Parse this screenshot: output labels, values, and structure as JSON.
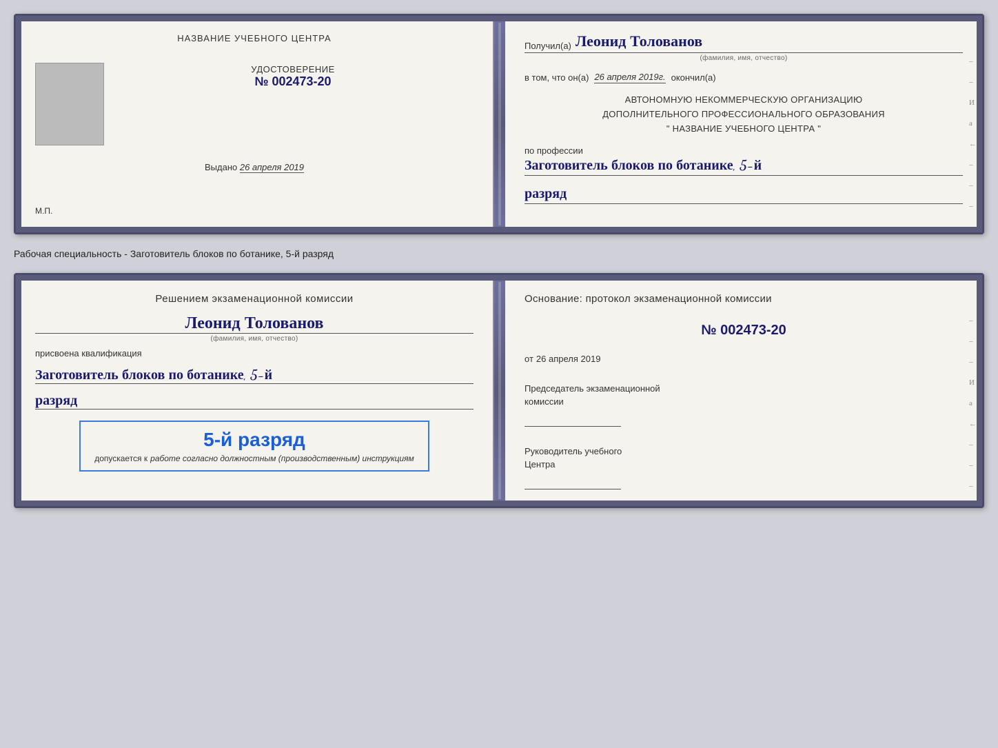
{
  "topCard": {
    "left": {
      "title": "НАЗВАНИЕ УЧЕБНОГО ЦЕНТРА",
      "certLabel": "УДОСТОВЕРЕНИЕ",
      "certNumber": "№ 002473-20",
      "issuedPrefix": "Выдано",
      "issuedDate": "26 апреля 2019",
      "mpLabel": "М.П."
    },
    "right": {
      "recipientPrefix": "Получил(а)",
      "recipientName": "Леонид Толованов",
      "recipientCaption": "(фамилия, имя, отчество)",
      "datePrefix": "в том, что он(а)",
      "date": "26 апреля 2019г.",
      "dateSuffix": "окончил(а)",
      "orgLine1": "АВТОНОМНУЮ НЕКОММЕРЧЕСКУЮ ОРГАНИЗАЦИЮ",
      "orgLine2": "ДОПОЛНИТЕЛЬНОГО ПРОФЕССИОНАЛЬНОГО ОБРАЗОВАНИЯ",
      "orgLine3": "\"  НАЗВАНИЕ УЧЕБНОГО ЦЕНТРА  \"",
      "professionPrefix": "по профессии",
      "professionValue": "Заготовитель блоков по ботанике, 5-й",
      "rankValue": "разряд"
    }
  },
  "infoLine": "Рабочая специальность - Заготовитель блоков по ботанике, 5-й разряд",
  "bottomCard": {
    "left": {
      "decisionHeader": "Решением экзаменационной комиссии",
      "personName": "Леонид Толованов",
      "personCaption": "(фамилия, имя, отчество)",
      "qualificationLabel": "присвоена квалификация",
      "qualificationValue": "Заготовитель блоков по ботанике, 5-й",
      "rankValue": "разряд",
      "stampTitle": "5-й разряд",
      "stampSubtitle": "допускается к",
      "stampItalic": "работе согласно должностным (производственным) инструкциям"
    },
    "right": {
      "basisText": "Основание: протокол экзаменационной комиссии",
      "protocolNumber": "№ 002473-20",
      "datePrefix": "от",
      "date": "26 апреля 2019",
      "chairmanLabel1": "Председатель экзаменационной",
      "chairmanLabel2": "комиссии",
      "headLabel1": "Руководитель учебного",
      "headLabel2": "Центра"
    }
  }
}
